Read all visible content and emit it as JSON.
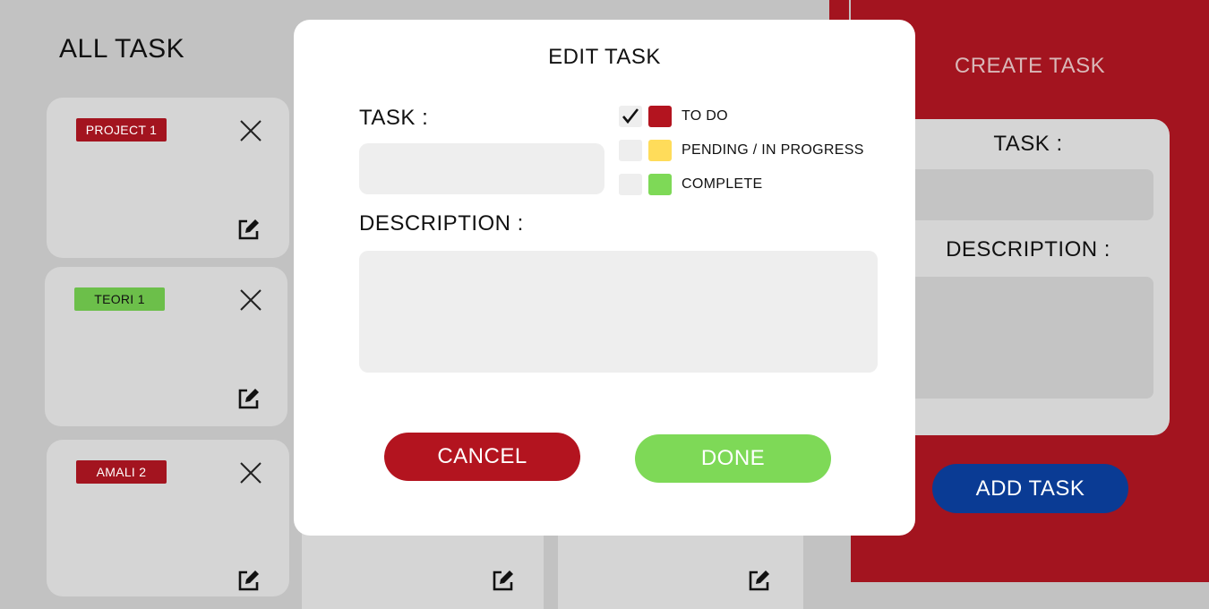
{
  "board": {
    "title": "ALL TASK",
    "cards": [
      {
        "badge": "PROJECT 1",
        "badge_color": "#a3141f",
        "badge_text_color": "#ffffff"
      },
      {
        "badge": "TEORI 1",
        "badge_color": "#6cbf4a",
        "badge_text_color": "#111111"
      },
      {
        "badge": "AMALI 2",
        "badge_color": "#a3141f",
        "badge_text_color": "#ffffff"
      }
    ]
  },
  "create_panel": {
    "title": "CREATE TASK",
    "task_label": "TASK :",
    "description_label": "DESCRIPTION :",
    "add_button": "ADD TASK"
  },
  "edit_modal": {
    "title": "EDIT TASK",
    "task_label": "TASK :",
    "description_label": "DESCRIPTION :",
    "task_value": "",
    "description_value": "",
    "statuses": [
      {
        "label": "TO DO",
        "color": "#b3141f",
        "checked": true
      },
      {
        "label": "PENDING / IN PROGRESS",
        "color": "#ffdc5a",
        "checked": false
      },
      {
        "label": "COMPLETE",
        "color": "#7ed957",
        "checked": false
      }
    ],
    "cancel_button": "CANCEL",
    "done_button": "DONE"
  },
  "colors": {
    "accent_red": "#a3141f",
    "cancel_red": "#b3141f",
    "done_green": "#7ed957",
    "add_blue": "#0a3b94",
    "background": "#c2c2c2"
  },
  "icons": {
    "card_close": "close-icon",
    "card_edit": "edit-icon",
    "status_check": "checkmark-icon"
  }
}
